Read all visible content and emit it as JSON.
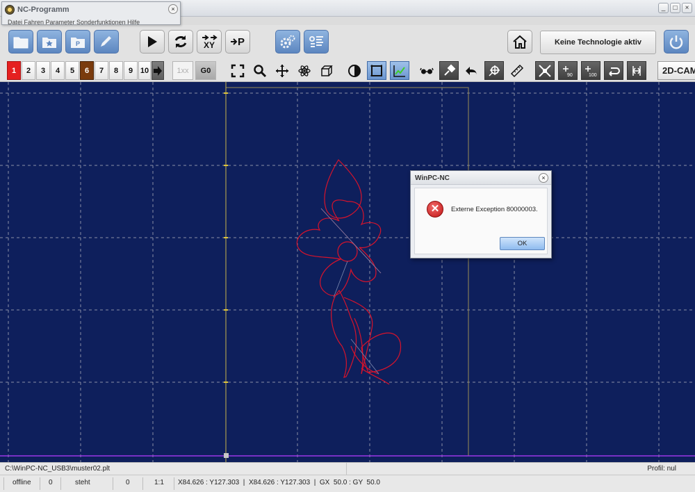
{
  "window": {
    "title": "",
    "controls": [
      "_",
      "□",
      "×"
    ]
  },
  "popup": {
    "title": "NC-Programm",
    "close": "×",
    "menu_items": "Datei   Fahren   Parameter   Sonderfunktionen   Hilfe"
  },
  "toolbar": {
    "technology_label": "Keine Technologie aktiv",
    "goto_xy_label": "XY",
    "goto_p_label": "P"
  },
  "tools": {
    "numbers": [
      "1",
      "2",
      "3",
      "4",
      "5",
      "6",
      "7",
      "8",
      "9",
      "10"
    ],
    "scale_label": "1xx",
    "g0_label": "G0",
    "cam_label": "2D-CAM"
  },
  "dialog": {
    "title": "WinPC-NC",
    "close": "×",
    "error_glyph": "✕",
    "message": "Externe Exception 80000003.",
    "ok_label": "OK"
  },
  "pathbar": {
    "file": "C:\\WinPC-NC_USB3\\muster02.plt",
    "profile": "Profil: nul"
  },
  "status": {
    "connection": "offline",
    "count1": "0",
    "state": "steht",
    "count2": "0",
    "scale": "1:1",
    "coords": "X84.626 : Y127.303  |  X84.626 : Y127.303  |  GX  50.0 : GY  50.0"
  },
  "colors": {
    "canvas_bg": "#0e1f5c",
    "drawing": "#d8132b",
    "accent": "#6b95cf"
  }
}
